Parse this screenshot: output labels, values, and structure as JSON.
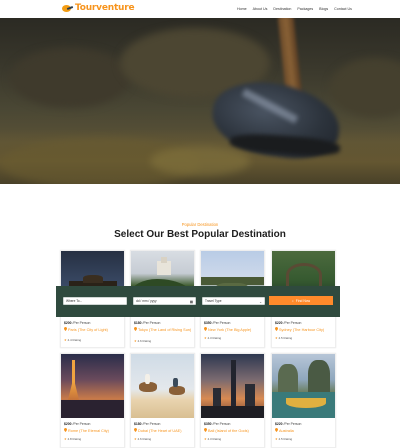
{
  "header": {
    "logo_text": "Tourventure",
    "nav": [
      "Home",
      "About Us",
      "Destination",
      "Packages",
      "Blogs",
      "Contact Us"
    ]
  },
  "section": {
    "subtitle": "Popular Destination",
    "title": "Select Our Best Popular Destination"
  },
  "booking": {
    "where_placeholder": "Where To...",
    "date_value": "dd / mm / yyyy",
    "travel_type": "Travel Type",
    "find_label": "Find Now"
  },
  "cards_row1": [
    {
      "price": "$200",
      "unit": "/Per Person",
      "name": "Paris (The City of Light)",
      "rating": "4.4 Rating"
    },
    {
      "price": "$180",
      "unit": "/Per Person",
      "name": "Tokyo (The Land of Rising Sun)",
      "rating": "4.6 Rating"
    },
    {
      "price": "$350",
      "unit": "/Per Person",
      "name": "New York (The Big Apple)",
      "rating": "4.3 Rating"
    },
    {
      "price": "$220",
      "unit": "/Per Person",
      "name": "Sydney (The Harbour City)",
      "rating": "4.5 Rating"
    }
  ],
  "cards_row2": [
    {
      "price": "$200",
      "unit": "/Per Person",
      "name": "Rome (The Eternal City)",
      "rating": "4.8 Rating"
    },
    {
      "price": "$180",
      "unit": "/Per Person",
      "name": "Dubai (The Heart of UAE)",
      "rating": "4.6 Rating"
    },
    {
      "price": "$350",
      "unit": "/Per Person",
      "name": "Bali (Island of the Gods)",
      "rating": "4.3 Rating"
    },
    {
      "price": "$220",
      "unit": "/Per Person",
      "name": "Australia",
      "rating": "4.5 Rating"
    }
  ],
  "colors": {
    "accent": "#f7941d",
    "booking_bg": "#2f4a3e",
    "button": "#ff8a2b"
  }
}
